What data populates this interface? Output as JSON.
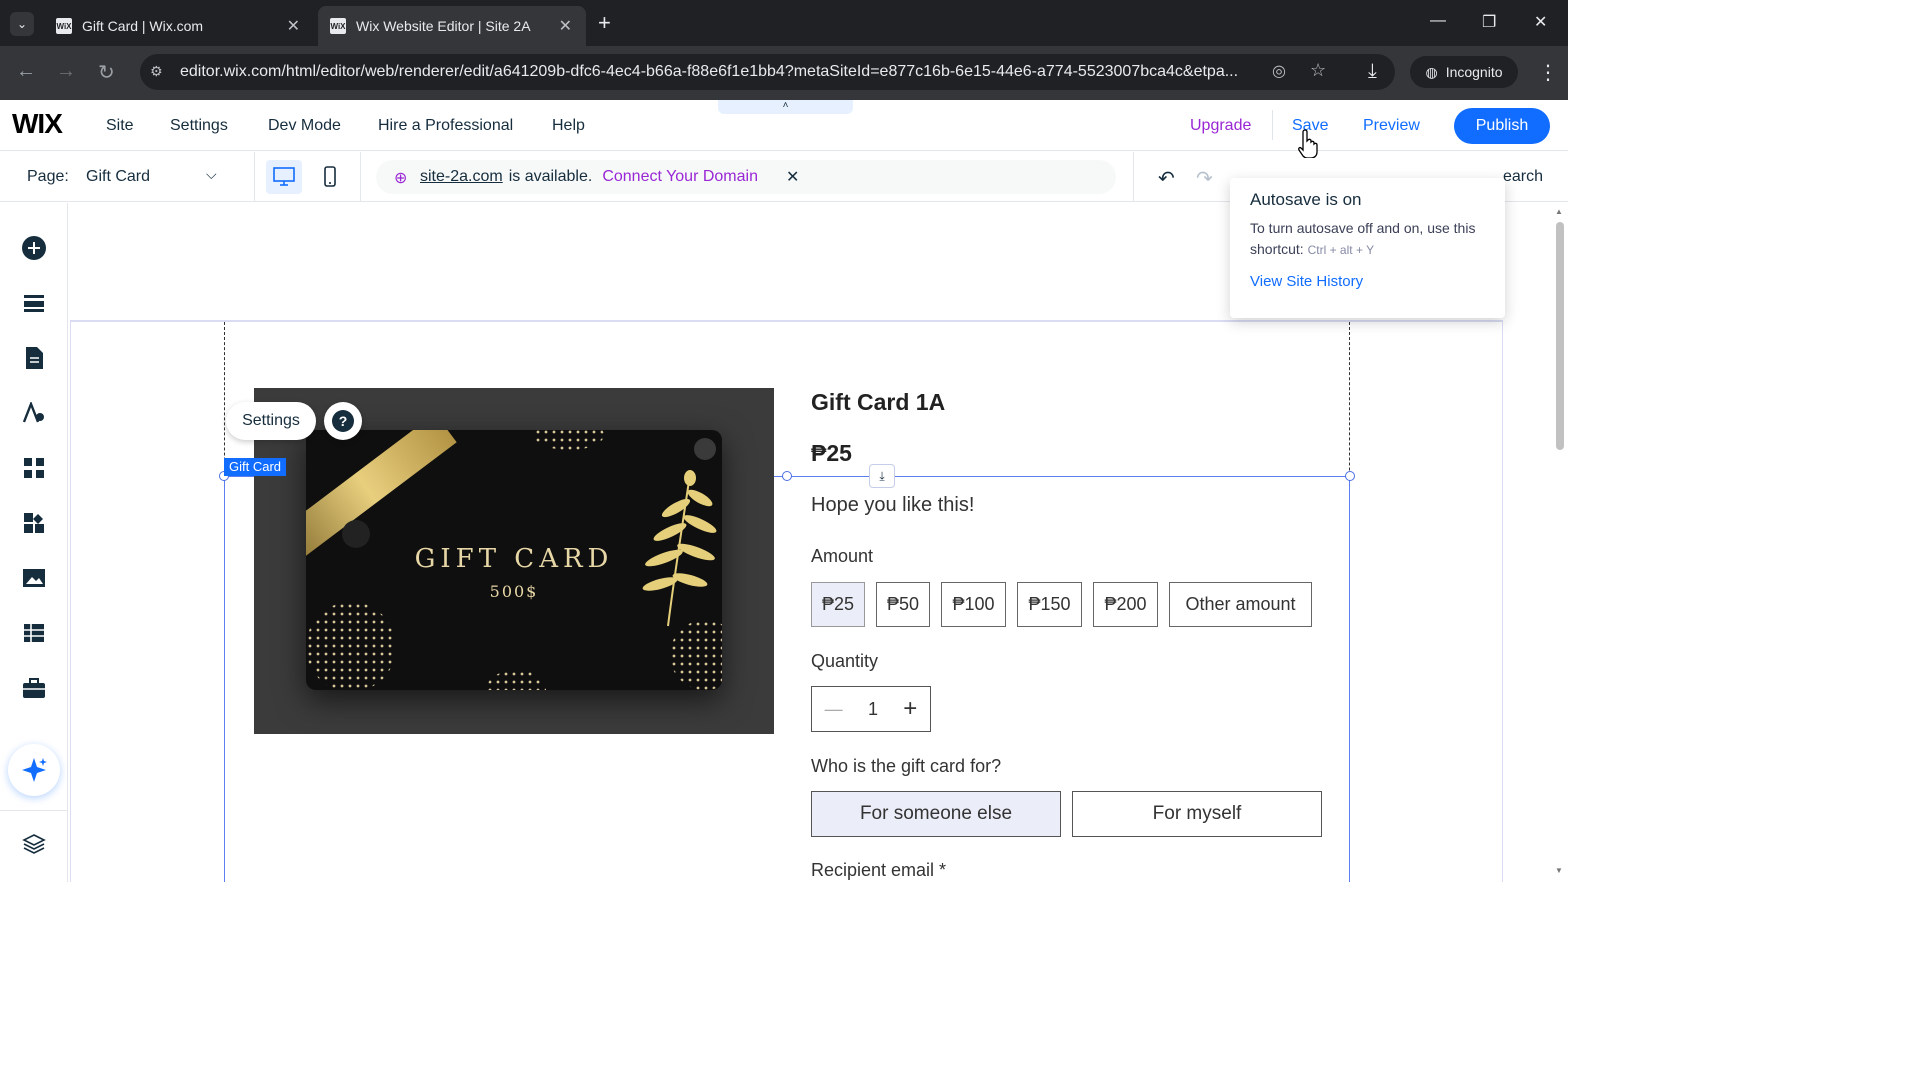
{
  "browser": {
    "tabs": [
      {
        "favicon": "WiX",
        "title": "Gift Card | Wix.com"
      },
      {
        "favicon": "WiX",
        "title": "Wix Website Editor | Site 2A"
      }
    ],
    "url": "editor.wix.com/html/editor/web/renderer/edit/a641209b-dfc6-4ec4-b66a-f88e6f1e1bb4?metaSiteId=e877c16b-6e15-44e6-a774-5523007bca4c&etpa...",
    "incognito_label": "Incognito"
  },
  "wix": {
    "logo": "WIX",
    "menu": [
      "Site",
      "Settings",
      "Dev Mode",
      "Hire a Professional",
      "Help"
    ],
    "upgrade": "Upgrade",
    "save": "Save",
    "preview": "Preview",
    "publish": "Publish",
    "collapse_glyph": "˄"
  },
  "page_bar": {
    "page_label": "Page:",
    "page_value": "Gift Card",
    "domain_name": "site-2a.com",
    "domain_text": "is available.",
    "connect_link": "Connect Your Domain",
    "search_text": "earch"
  },
  "autosave": {
    "title": "Autosave is on",
    "body": "To turn autosave off and on, use this shortcut:",
    "shortcut": "Ctrl + alt + Y",
    "link": "View Site History"
  },
  "canvas": {
    "settings_btn": "Settings",
    "element_label": "Gift Card",
    "card_title": "GIFT CARD",
    "card_value": "500$"
  },
  "product": {
    "title": "Gift Card 1A",
    "price": "₱25",
    "description": "Hope you like this!",
    "amount_label": "Amount",
    "amounts": [
      "₱25",
      "₱50",
      "₱100",
      "₱150",
      "₱200",
      "Other amount"
    ],
    "selected_amount": "₱25",
    "quantity_label": "Quantity",
    "quantity": "1",
    "minus": "—",
    "plus": "+",
    "who_label": "Who is the gift card for?",
    "who_options": [
      "For someone else",
      "For myself"
    ],
    "recipient_label": "Recipient email *"
  },
  "colors": {
    "accent": "#116dff",
    "upgrade": "#9a27d5",
    "selection": "#5b7ef0"
  }
}
